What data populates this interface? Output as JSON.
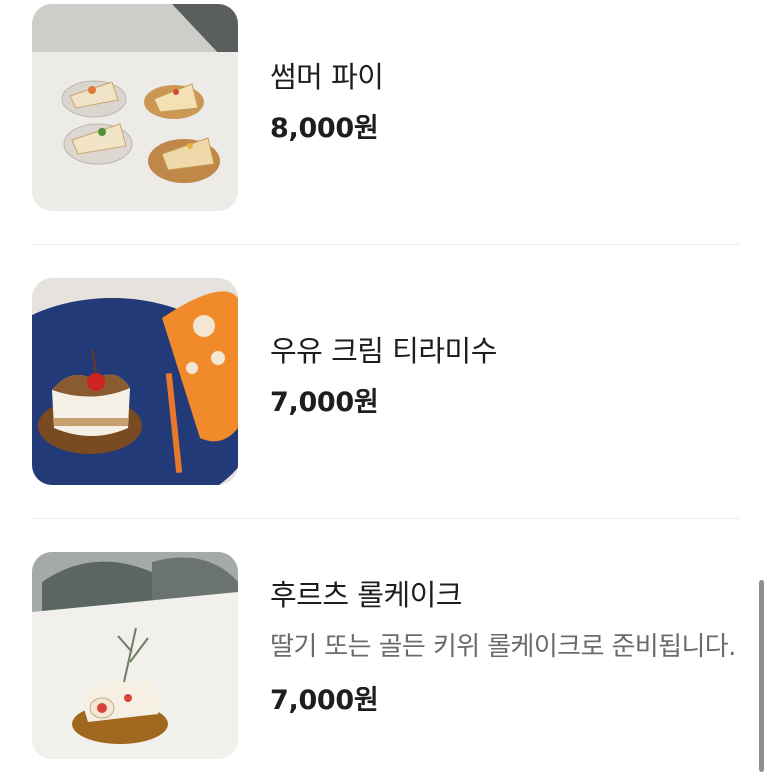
{
  "menu": {
    "items": [
      {
        "name": "썸머 파이",
        "price": "8,000원",
        "image": "summer-pie-photo"
      },
      {
        "name": "우유 크림 티라미수",
        "price": "7,000원",
        "image": "milk-cream-tiramisu-photo"
      },
      {
        "name": "후르츠 롤케이크",
        "description": "딸기 또는 골든 키위 롤케이크로 준비됩니다.",
        "price": "7,000원",
        "image": "fruit-roll-cake-photo"
      }
    ]
  },
  "colors": {
    "background": "#ffffff",
    "text_primary": "#1e1e1e",
    "text_secondary": "#6b6b6b",
    "divider": "#eeeeee",
    "scrollbar": "#8f8f8f"
  }
}
